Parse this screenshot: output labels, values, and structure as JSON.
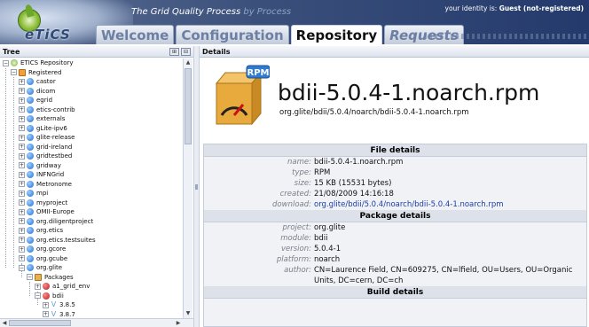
{
  "header": {
    "logo_text": "eTiCS",
    "tagline": "The Grid Quality Process",
    "tagline_faint": " by Process",
    "identity_prefix": "your identity is:",
    "identity_user": "Guest (not-registered)",
    "tabs": [
      {
        "label": "Welcome",
        "active": false
      },
      {
        "label": "Configuration",
        "active": false
      },
      {
        "label": "Repository",
        "active": true
      },
      {
        "label": "Requests",
        "active": false
      }
    ]
  },
  "tree": {
    "title": "Tree",
    "root": "ETICS Repository",
    "registered": "Registered",
    "projects": [
      "castor",
      "dicom",
      "egrid",
      "etics-contrib",
      "externals",
      "gLite-ipv6",
      "glite-release",
      "grid-ireland",
      "gridtestbed",
      "gridway",
      "INFNGrid",
      "Metronome",
      "mpi",
      "myproject",
      "OMII-Europe",
      "org.diligentproject",
      "org.etics",
      "org.etics.testsuites",
      "org.gcore",
      "org.gcube",
      "org.glite"
    ],
    "packages_label": "Packages",
    "modules": [
      "a1_grid_env",
      "bdii"
    ],
    "versions": [
      "3.8.5",
      "3.8.7"
    ]
  },
  "details": {
    "title": "Details",
    "icon_badge": "RPM",
    "package_name": "bdii-5.0.4-1.noarch.rpm",
    "package_path": "org.glite/bdii/5.0.4/noarch/bdii-5.0.4-1.noarch.rpm",
    "file_details": {
      "heading": "File details",
      "rows": [
        {
          "key": "name:",
          "value": "bdii-5.0.4-1.noarch.rpm"
        },
        {
          "key": "type:",
          "value": "RPM"
        },
        {
          "key": "size:",
          "value": "15 KB (15531 bytes)"
        },
        {
          "key": "created:",
          "value": "21/08/2009 14:16:18"
        },
        {
          "key": "download:",
          "value": "org.glite/bdii/5.0.4/noarch/bdii-5.0.4-1.noarch.rpm"
        }
      ]
    },
    "package_details": {
      "heading": "Package details",
      "rows": [
        {
          "key": "project:",
          "value": "org.glite"
        },
        {
          "key": "module:",
          "value": "bdii"
        },
        {
          "key": "version:",
          "value": "5.0.4-1"
        },
        {
          "key": "platform:",
          "value": "noarch"
        },
        {
          "key": "author:",
          "value": "CN=Laurence Field, CN=609275, CN=lfield, OU=Users, OU=Organic Units, DC=cern, DC=ch"
        }
      ]
    },
    "build_details": {
      "heading": "Build details"
    }
  },
  "colors": {
    "header_dark": "#243a6c",
    "link": "#1a3ca8",
    "section_bg": "#dde2ea"
  }
}
